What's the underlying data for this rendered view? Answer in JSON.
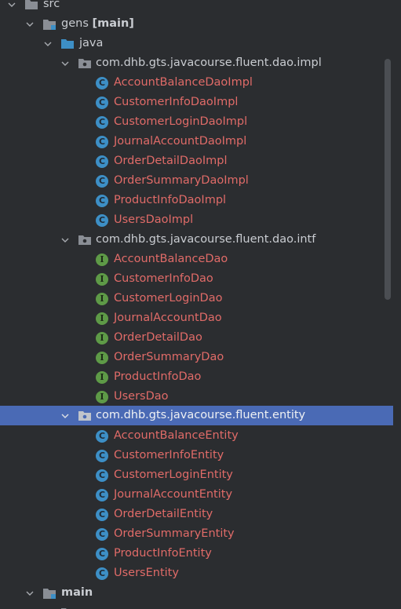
{
  "tree": {
    "src_label": "src",
    "gens_label": "gens",
    "gens_branch": "[main]",
    "java_label": "java",
    "packages": [
      {
        "name": "com.dhb.gts.javacourse.fluent.dao.impl",
        "kind": "class",
        "items": [
          "AccountBalanceDaoImpl",
          "CustomerInfoDaoImpl",
          "CustomerLoginDaoImpl",
          "JournalAccountDaoImpl",
          "OrderDetailDaoImpl",
          "OrderSummaryDaoImpl",
          "ProductInfoDaoImpl",
          "UsersDaoImpl"
        ]
      },
      {
        "name": "com.dhb.gts.javacourse.fluent.dao.intf",
        "kind": "interface",
        "items": [
          "AccountBalanceDao",
          "CustomerInfoDao",
          "CustomerLoginDao",
          "JournalAccountDao",
          "OrderDetailDao",
          "OrderSummaryDao",
          "ProductInfoDao",
          "UsersDao"
        ]
      },
      {
        "name": "com.dhb.gts.javacourse.fluent.entity",
        "kind": "class",
        "selected": true,
        "items": [
          "AccountBalanceEntity",
          "CustomerInfoEntity",
          "CustomerLoginEntity",
          "JournalAccountEntity",
          "OrderDetailEntity",
          "OrderSummaryEntity",
          "ProductInfoEntity",
          "UsersEntity"
        ]
      }
    ],
    "main_label": "main",
    "class_icon_letter": "C",
    "interface_icon_letter": "I"
  },
  "colors": {
    "background": "#2b2d30",
    "selection": "#4a6ab5",
    "error_text": "#e06b68",
    "class_icon": "#3d8fc6",
    "interface_icon": "#5e9a47"
  }
}
